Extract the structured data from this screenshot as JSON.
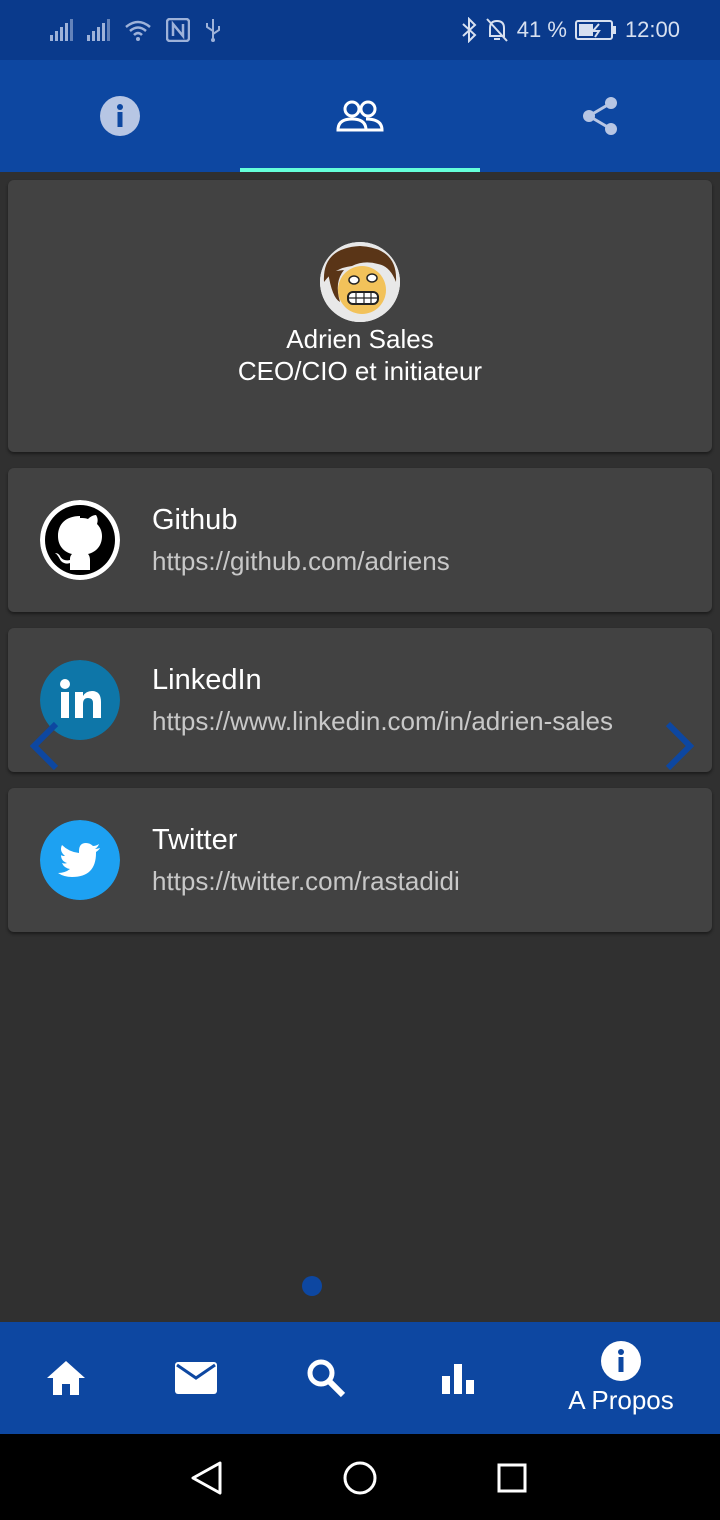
{
  "status_bar": {
    "battery_percent": "41 %",
    "time": "12:00",
    "icons": [
      "signal-icon",
      "signal-icon",
      "wifi-icon",
      "nfc-icon",
      "usb-icon",
      "bluetooth-icon",
      "notifications-off-icon",
      "battery-charging-icon"
    ]
  },
  "tabs": [
    {
      "icon": "info-icon",
      "active": false
    },
    {
      "icon": "people-icon",
      "active": true
    },
    {
      "icon": "share-icon",
      "active": false
    }
  ],
  "profile": {
    "name": "Adrien Sales",
    "role": "CEO/CIO et initiateur"
  },
  "links": [
    {
      "title": "Github",
      "url": "https://github.com/adriens",
      "icon": "github-logo-icon"
    },
    {
      "title": "LinkedIn",
      "url": "https://www.linkedin.com/in/adrien-sales",
      "icon": "linkedin-logo-icon"
    },
    {
      "title": "Twitter",
      "url": "https://twitter.com/rastadidi",
      "icon": "twitter-logo-icon"
    }
  ],
  "carousel": {
    "page_count": 1,
    "current_page": 1
  },
  "bottom_nav": {
    "items": [
      {
        "icon": "home-icon",
        "label": ""
      },
      {
        "icon": "mail-icon",
        "label": ""
      },
      {
        "icon": "search-icon",
        "label": ""
      },
      {
        "icon": "bar-chart-icon",
        "label": ""
      },
      {
        "icon": "info-icon",
        "label": "A Propos"
      }
    ]
  },
  "colors": {
    "status_bar": "#0a3a8c",
    "primary": "#0d47a1",
    "tab_indicator": "#64ffda",
    "background": "#303030",
    "card": "#424242"
  }
}
